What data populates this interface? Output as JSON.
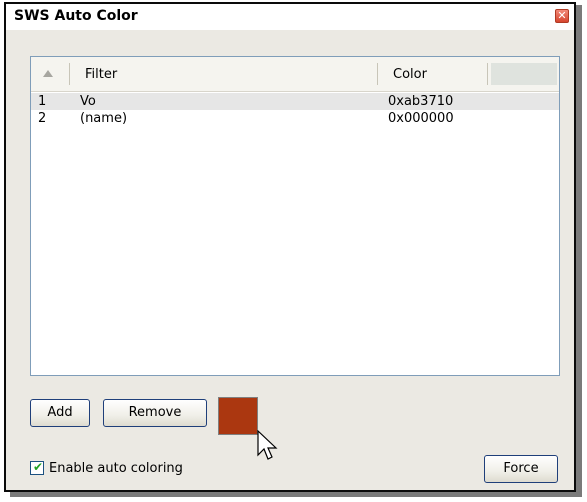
{
  "window": {
    "title": "SWS Auto Color",
    "close_glyph": "✕"
  },
  "list": {
    "columns": [
      {
        "label": "Filter"
      },
      {
        "label": "Color"
      }
    ],
    "sort_icon": "sort-ascending-icon",
    "rows": [
      {
        "num": "1",
        "filter": "Vo",
        "color": "0xab3710",
        "selected": true
      },
      {
        "num": "2",
        "filter": "(name)",
        "color": "0x000000",
        "selected": false
      }
    ]
  },
  "buttons": {
    "add": "Add",
    "remove": "Remove",
    "force": "Force"
  },
  "swatch": {
    "color": "#ab3710"
  },
  "auto_coloring": {
    "label": "Enable auto coloring",
    "checked": true
  },
  "cursor_icon": "mouse-pointer-icon"
}
